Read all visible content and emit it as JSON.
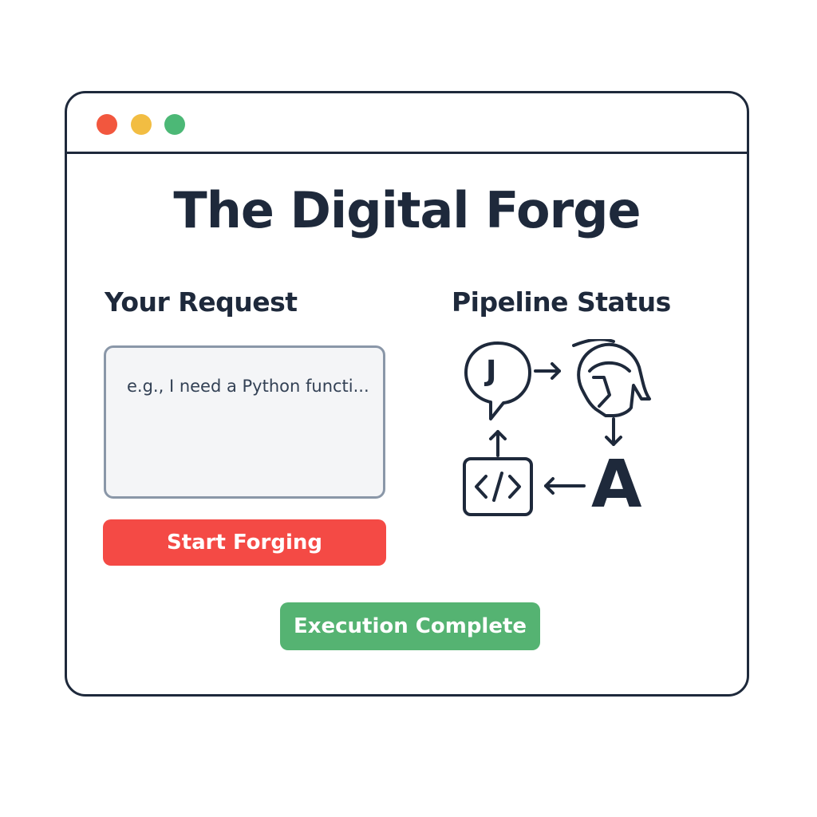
{
  "window": {
    "controls": [
      "close",
      "minimize",
      "maximize"
    ]
  },
  "page": {
    "title": "The Digital Forge"
  },
  "request": {
    "heading": "Your Request",
    "placeholder": "e.g., I need a Python functi..."
  },
  "actions": {
    "start_label": "Start Forging"
  },
  "pipeline": {
    "heading": "Pipeline Status",
    "agent_j_letter": "J",
    "agent_a_letter": "A",
    "icons": [
      "chat-bubble-icon",
      "spartan-helmet-icon",
      "code-icon",
      "letter-a-icon"
    ]
  },
  "status": {
    "label": "Execution Complete"
  },
  "colors": {
    "close": "#f2573e",
    "minimize": "#f2bd42",
    "maximize": "#4cb876",
    "primary_button": "#f44a45",
    "success_badge": "#55b372",
    "text": "#1e293b"
  }
}
